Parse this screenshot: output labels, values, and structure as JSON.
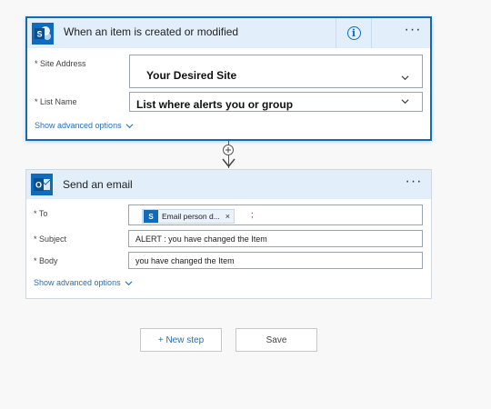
{
  "trigger": {
    "title": "When an item is created or modified",
    "icon": "sharepoint-icon",
    "brand_color": "#0f6cbd",
    "info_icon": "info-icon",
    "more_icon": "more-icon",
    "more_label": "···",
    "fields": [
      {
        "label": "Site Address",
        "required_mark": "*",
        "value": "Your Desired Site"
      },
      {
        "label": "List Name",
        "required_mark": "*",
        "value": "List where alerts you or group"
      }
    ],
    "advanced_label": "Show advanced options"
  },
  "action": {
    "title": "Send an email",
    "icon": "outlook-icon",
    "brand_color": "#0f6cbd",
    "more_icon": "more-icon",
    "more_label": "···",
    "to": {
      "label": "To",
      "required_mark": "*",
      "token_label": "Email person d...",
      "token_remove": "×",
      "separator": ";"
    },
    "subject": {
      "label": "Subject",
      "required_mark": "*",
      "value": "ALERT : you have changed the Item"
    },
    "body": {
      "label": "Body",
      "required_mark": "*",
      "value": "you have changed the Item"
    },
    "advanced_label": "Show advanced options"
  },
  "buttons": {
    "new_step": "+ New step",
    "save": "Save"
  }
}
